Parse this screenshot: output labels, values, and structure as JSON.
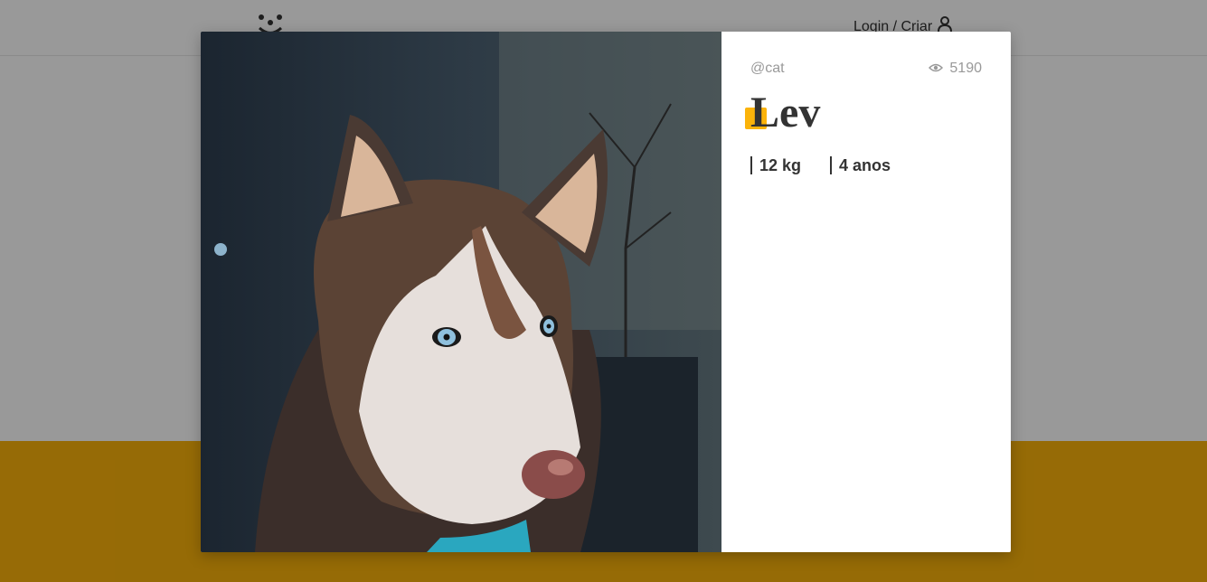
{
  "header": {
    "logo_icon": "dog-face-logo-icon",
    "login_label": "Login / Criar",
    "user_icon": "user-icon"
  },
  "photo": {
    "alt": "Lev"
  },
  "details": {
    "author": "@cat",
    "views_icon": "eye-icon",
    "views": "5190",
    "title": "Lev",
    "weight": "12 kg",
    "age": "4 anos"
  },
  "colors": {
    "accent": "#fbb30a",
    "text": "#333333",
    "muted": "#999999"
  }
}
